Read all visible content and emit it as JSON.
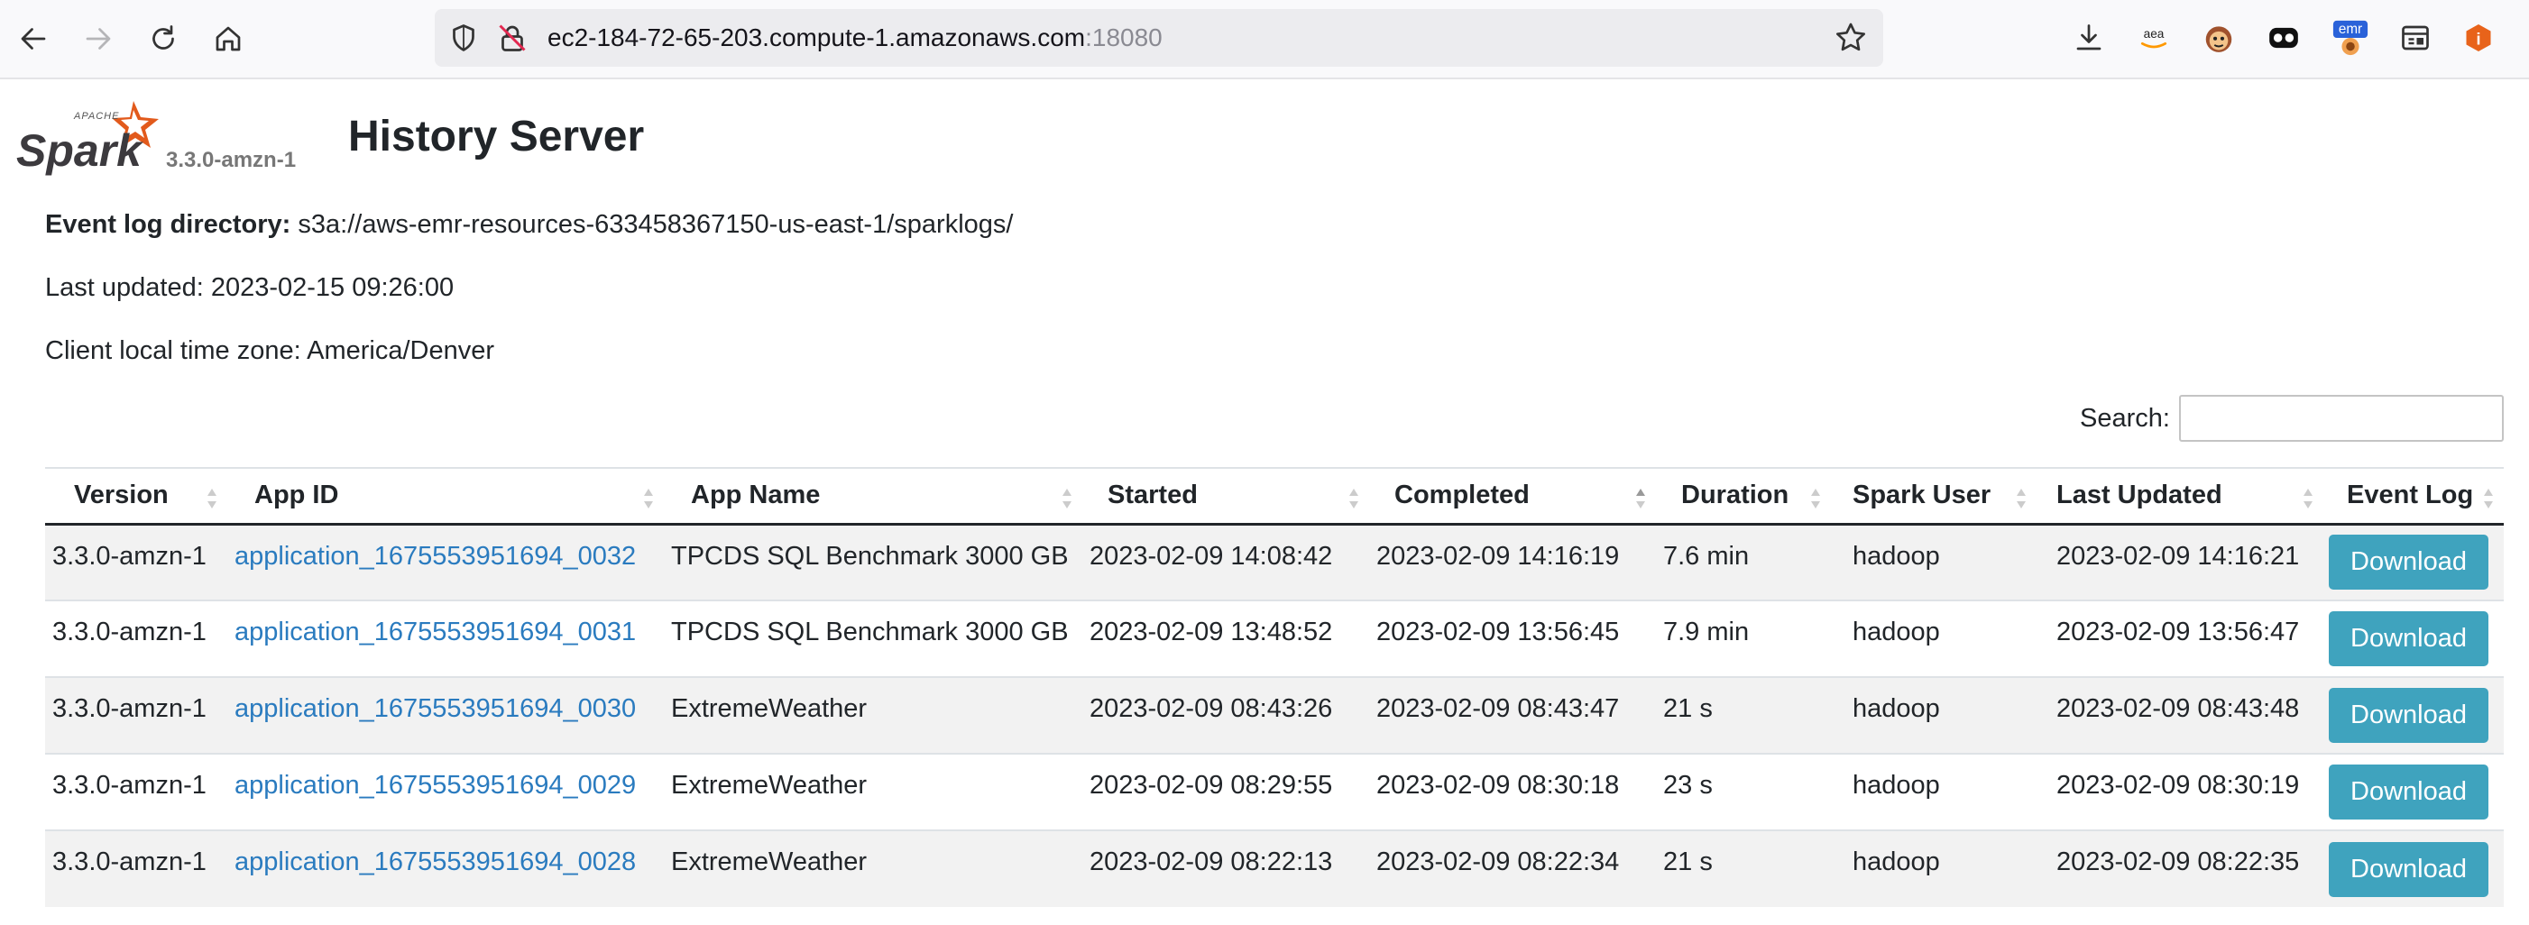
{
  "browser": {
    "url_host": "ec2-184-72-65-203.compute-1.amazonaws.com",
    "url_port": ":18080",
    "extensions": [
      "download-icon",
      "aea-extension-icon",
      "monkey-extension-icon",
      "mask-extension-icon",
      "emr-extension-icon",
      "reader-icon",
      "info-extension-icon"
    ],
    "emr_badge": "emr",
    "aea_label": "aea"
  },
  "header": {
    "spark_brand": "Spark",
    "apache_label": "APACHE",
    "version": "3.3.0-amzn-1",
    "title": "History Server"
  },
  "info": {
    "event_log_label": "Event log directory:",
    "event_log_value": "s3a://aws-emr-resources-633458367150-us-east-1/sparklogs/",
    "last_updated": "Last updated: 2023-02-15 09:26:00",
    "timezone": "Client local time zone: America/Denver"
  },
  "search": {
    "label": "Search:",
    "value": ""
  },
  "table": {
    "columns": [
      "Version",
      "App ID",
      "App Name",
      "Started",
      "Completed",
      "Duration",
      "Spark User",
      "Last Updated",
      "Event Log"
    ],
    "rows": [
      {
        "version": "3.3.0-amzn-1",
        "app_id": "application_1675553951694_0032",
        "app_name": "TPCDS SQL Benchmark 3000 GB",
        "started": "2023-02-09 14:08:42",
        "completed": "2023-02-09 14:16:19",
        "duration": "7.6 min",
        "user": "hadoop",
        "last_updated": "2023-02-09 14:16:21",
        "action": "Download"
      },
      {
        "version": "3.3.0-amzn-1",
        "app_id": "application_1675553951694_0031",
        "app_name": "TPCDS SQL Benchmark 3000 GB",
        "started": "2023-02-09 13:48:52",
        "completed": "2023-02-09 13:56:45",
        "duration": "7.9 min",
        "user": "hadoop",
        "last_updated": "2023-02-09 13:56:47",
        "action": "Download"
      },
      {
        "version": "3.3.0-amzn-1",
        "app_id": "application_1675553951694_0030",
        "app_name": "ExtremeWeather",
        "started": "2023-02-09 08:43:26",
        "completed": "2023-02-09 08:43:47",
        "duration": "21 s",
        "user": "hadoop",
        "last_updated": "2023-02-09 08:43:48",
        "action": "Download"
      },
      {
        "version": "3.3.0-amzn-1",
        "app_id": "application_1675553951694_0029",
        "app_name": "ExtremeWeather",
        "started": "2023-02-09 08:29:55",
        "completed": "2023-02-09 08:30:18",
        "duration": "23 s",
        "user": "hadoop",
        "last_updated": "2023-02-09 08:30:19",
        "action": "Download"
      },
      {
        "version": "3.3.0-amzn-1",
        "app_id": "application_1675553951694_0028",
        "app_name": "ExtremeWeather",
        "started": "2023-02-09 08:22:13",
        "completed": "2023-02-09 08:22:34",
        "duration": "21 s",
        "user": "hadoop",
        "last_updated": "2023-02-09 08:22:35",
        "action": "Download"
      }
    ]
  },
  "colors": {
    "link": "#2a7bbf",
    "button": "#3fa3be",
    "spark_orange": "#e25a1c"
  }
}
